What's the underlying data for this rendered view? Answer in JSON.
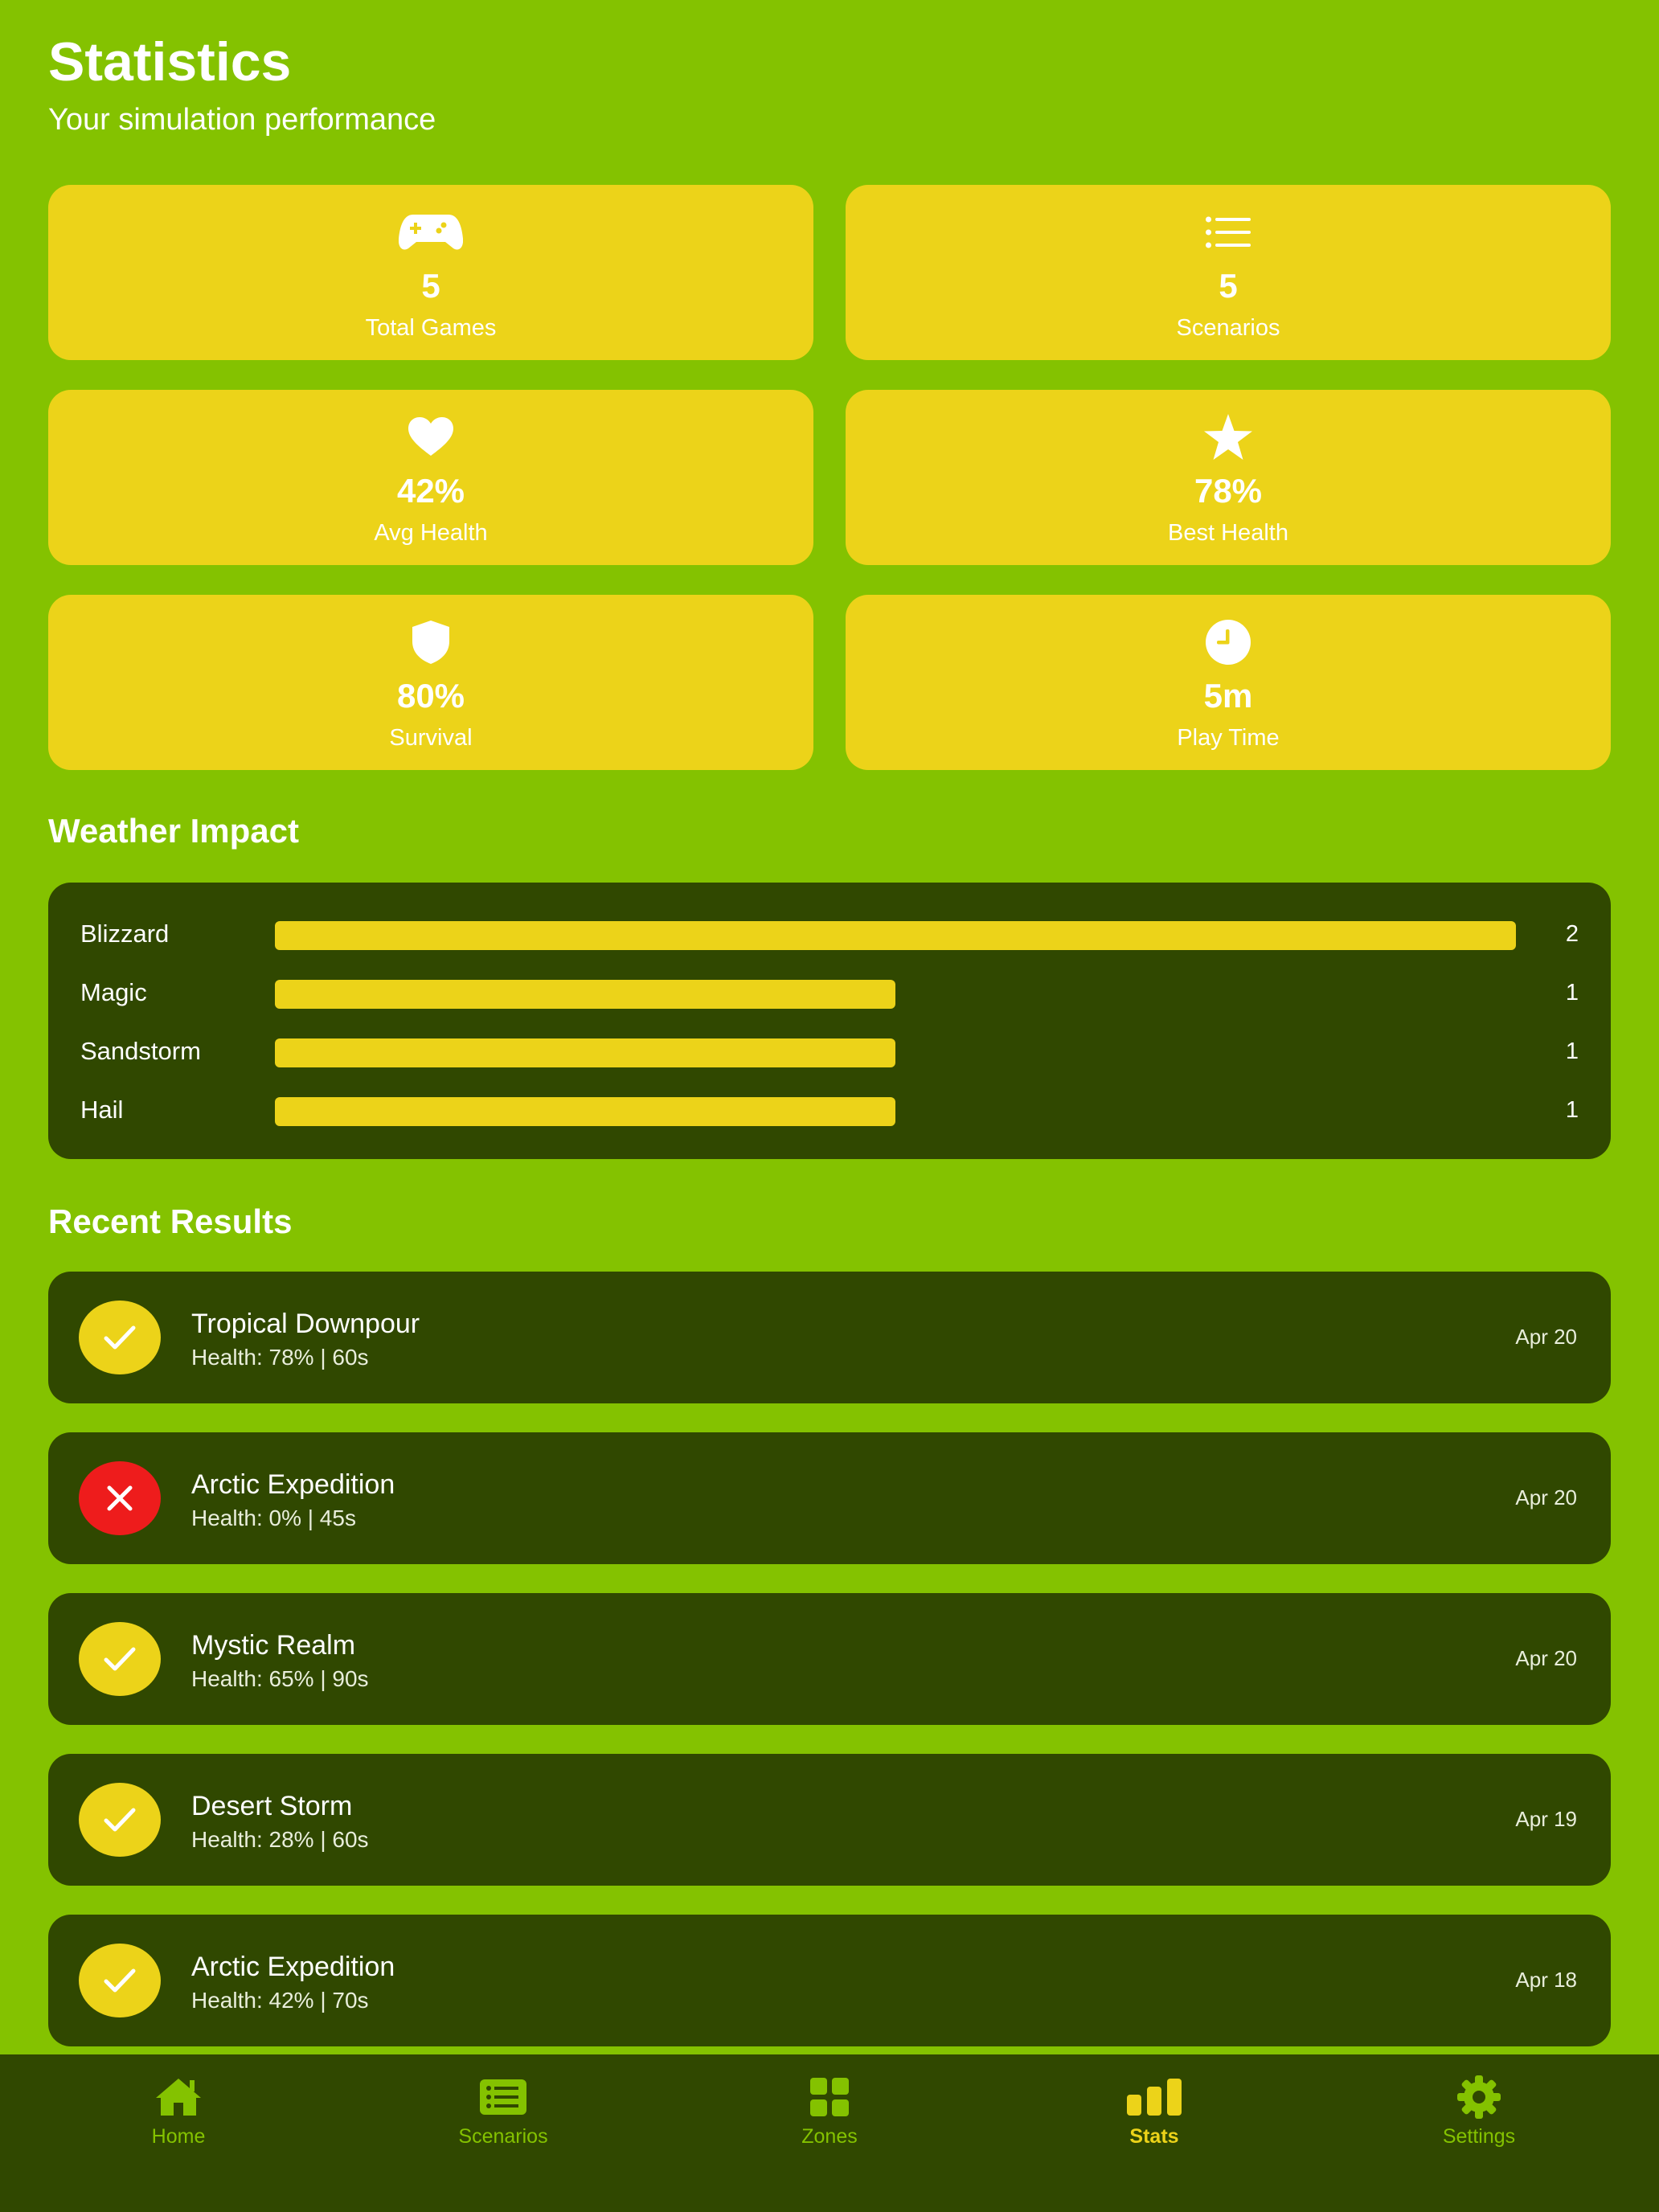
{
  "header": {
    "title": "Statistics",
    "subtitle": "Your simulation performance"
  },
  "stats": [
    {
      "icon": "gamepad-icon",
      "value": "5",
      "label": "Total Games"
    },
    {
      "icon": "list-icon",
      "value": "5",
      "label": "Scenarios"
    },
    {
      "icon": "heart-icon",
      "value": "42%",
      "label": "Avg Health"
    },
    {
      "icon": "star-icon",
      "value": "78%",
      "label": "Best Health"
    },
    {
      "icon": "shield-icon",
      "value": "80%",
      "label": "Survival"
    },
    {
      "icon": "clock-icon",
      "value": "5m",
      "label": "Play Time"
    }
  ],
  "weather": {
    "title": "Weather Impact",
    "max": 2,
    "rows": [
      {
        "label": "Blizzard",
        "count": 2
      },
      {
        "label": "Magic",
        "count": 1
      },
      {
        "label": "Sandstorm",
        "count": 1
      },
      {
        "label": "Hail",
        "count": 1
      }
    ]
  },
  "results": {
    "title": "Recent Results",
    "items": [
      {
        "name": "Tropical Downpour",
        "detail": "Health: 78% | 60s",
        "date": "Apr 20",
        "status": "success"
      },
      {
        "name": "Arctic Expedition",
        "detail": "Health: 0% | 45s",
        "date": "Apr 20",
        "status": "failure"
      },
      {
        "name": "Mystic Realm",
        "detail": "Health: 65% | 90s",
        "date": "Apr 20",
        "status": "success"
      },
      {
        "name": "Desert Storm",
        "detail": "Health: 28% | 60s",
        "date": "Apr 19",
        "status": "success"
      },
      {
        "name": "Arctic Expedition",
        "detail": "Health: 42% | 70s",
        "date": "Apr 18",
        "status": "success"
      }
    ]
  },
  "tabs": [
    {
      "label": "Home",
      "icon": "house-icon",
      "active": false
    },
    {
      "label": "Scenarios",
      "icon": "list-card-icon",
      "active": false
    },
    {
      "label": "Zones",
      "icon": "grid-icon",
      "active": false
    },
    {
      "label": "Stats",
      "icon": "bar-chart-icon",
      "active": true
    },
    {
      "label": "Settings",
      "icon": "gear-icon",
      "active": false
    }
  ],
  "colors": {
    "background": "#84c200",
    "card": "#ecd319",
    "panel": "#304800",
    "failure": "#ee1c1c"
  }
}
